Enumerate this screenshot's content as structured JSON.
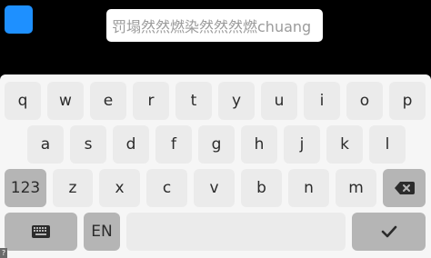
{
  "input": {
    "value": "罚塌然然燃染然然然燃chuang"
  },
  "keyboard": {
    "row1": [
      "q",
      "w",
      "e",
      "r",
      "t",
      "y",
      "u",
      "i",
      "o",
      "p"
    ],
    "row2": [
      "a",
      "s",
      "d",
      "f",
      "g",
      "h",
      "j",
      "k",
      "l"
    ],
    "row3": [
      "z",
      "x",
      "c",
      "v",
      "b",
      "n",
      "m"
    ],
    "numbers_label": "123",
    "language_label": "EN",
    "icons": {
      "backspace": "backspace-icon",
      "keyboard": "keyboard-icon",
      "confirm": "checkmark-icon"
    }
  },
  "corner_mark": "?",
  "colors": {
    "app_icon": "#1e90ff",
    "keyboard_bg": "#f6f6f6",
    "key_light": "#ebebeb",
    "key_dark": "#b5b5b5"
  }
}
